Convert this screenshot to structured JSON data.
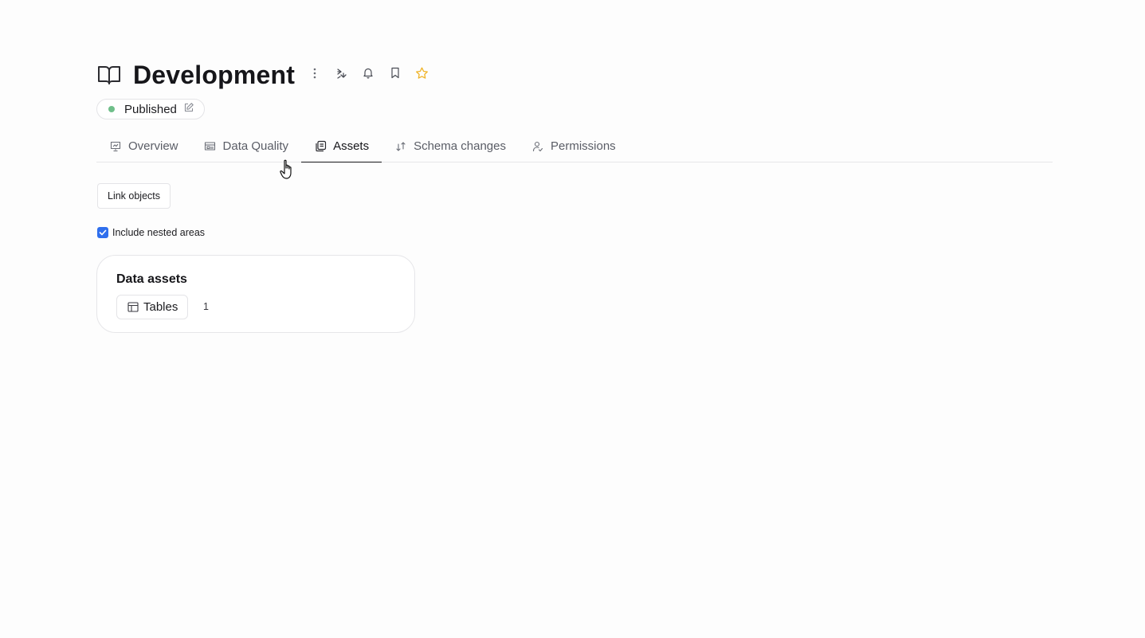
{
  "header": {
    "title": "Development",
    "icons": [
      "book-icon",
      "more-vertical-icon",
      "lineage-icon",
      "bell-icon",
      "bookmark-icon",
      "star-icon"
    ]
  },
  "status": {
    "label": "Published",
    "dot_color": "#6fbf8a",
    "icon": "edit-icon"
  },
  "tabs": [
    {
      "label": "Overview",
      "icon": "presentation-icon",
      "active": false
    },
    {
      "label": "Data Quality",
      "icon": "data-quality-icon",
      "active": false
    },
    {
      "label": "Assets",
      "icon": "assets-icon",
      "active": true
    },
    {
      "label": "Schema changes",
      "icon": "schema-changes-icon",
      "active": false
    },
    {
      "label": "Permissions",
      "icon": "permissions-icon",
      "active": false
    }
  ],
  "toolbar": {
    "link_objects_label": "Link objects"
  },
  "nested": {
    "label": "Include nested areas",
    "checked": true
  },
  "card": {
    "title": "Data assets",
    "tables_label": "Tables",
    "tables_count": "1"
  },
  "colors": {
    "accent": "#2f6fed",
    "star": "#f0b429",
    "text": "#16161a",
    "muted": "#5a5d66"
  }
}
